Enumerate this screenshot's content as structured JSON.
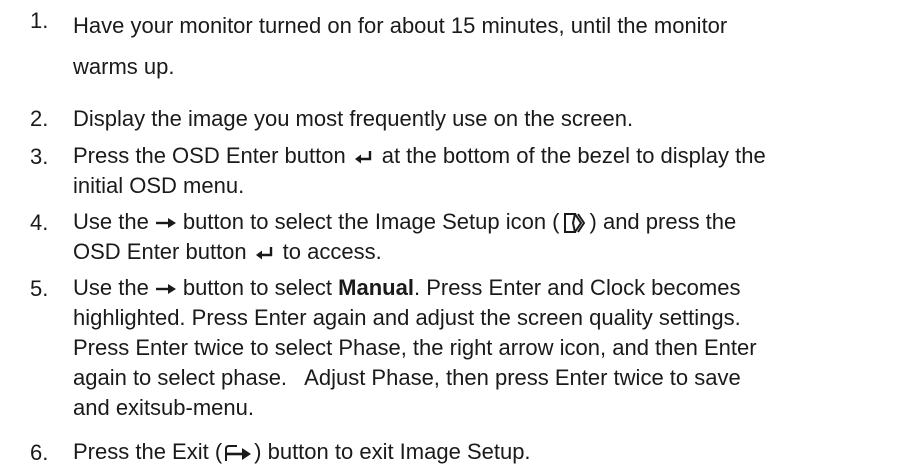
{
  "steps": [
    {
      "number": "1.",
      "line1": "Have your monitor turned on for about 15 minutes, until the monitor",
      "line2": "warms up."
    },
    {
      "number": "2.",
      "text": "Display the image you most frequently use on the screen."
    },
    {
      "number": "3.",
      "part1": "Press the OSD Enter button",
      "icon": "enter-icon",
      "part2": "at the bottom of the bezel to display the",
      "part3": "initial OSD menu."
    },
    {
      "number": "4.",
      "part1": "Use the",
      "icon1": "right-arrow-icon",
      "part2": "button to select the Image Setup icon (",
      "icon2": "image-setup-icon",
      "part3": ") and press the",
      "part4": "OSD Enter button",
      "icon3": "enter-icon",
      "part5": "to access."
    },
    {
      "number": "5.",
      "part1": "Use the",
      "icon": "right-arrow-icon",
      "part2": "button to select",
      "bold": "Manual",
      "part3": ". Press Enter and Clock becomes",
      "line2": "highlighted. Press Enter again and adjust the screen quality settings.",
      "line3": "Press Enter twice to select Phase, the right arrow icon, and then Enter",
      "line4": "again to select phase.   Adjust Phase, then press Enter twice to save",
      "line5": "and exitsub-menu."
    },
    {
      "number": "6.",
      "part1": "Press the Exit (",
      "icon": "exit-icon",
      "part2": ") button to exit Image Setup."
    }
  ]
}
